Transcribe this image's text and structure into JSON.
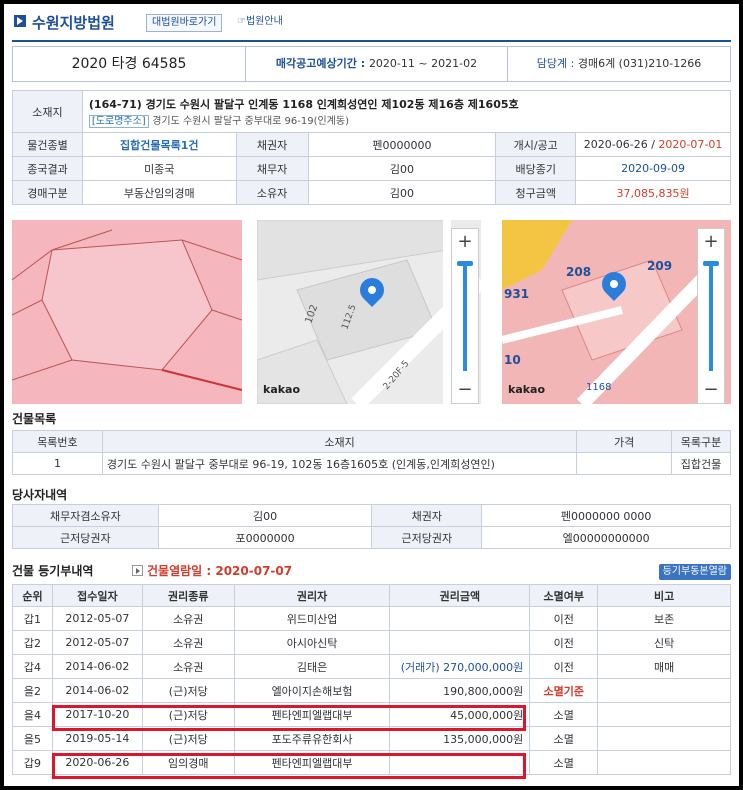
{
  "header": {
    "court_name": "수원지방법원",
    "shortcut_button": "대법원바로가기",
    "guide_button": "법원안내",
    "case_number": "2020 타경 64585",
    "period_label": "매각공고예상기간 : ",
    "period_value": "2020-11 ~ 2021-02",
    "charge_label": "담당계 : ",
    "charge_value": "경매6계 (031)210-1266"
  },
  "info": {
    "location_label": "소재지",
    "address_main": "(164-71) 경기도 수원시 팔달구 인계동 1168 인계희성연인 제102동 제16층 제1605호",
    "road_tag": "[도로명주소]",
    "road_address": "경기도 수원시 팔달구 중부대로 96-19(인계동)",
    "item_type_label": "물건종별",
    "item_type_value": "집합건물목록1건",
    "creditor_label": "채권자",
    "creditor_value": "펜0000000",
    "start_label": "개시/공고",
    "start_value": "2020-06-26 / ",
    "notice_value": "2020-07-01",
    "end_result_label": "종국결과",
    "end_result_value": "미종국",
    "debtor_label": "채무자",
    "debtor_value": "김00",
    "dividend_label": "배당종기",
    "dividend_value": "2020-09-09",
    "auction_type_label": "경매구분",
    "auction_type_value": "부동산임의경매",
    "owner_label": "소유자",
    "owner_value": "김00",
    "claim_label": "청구금액",
    "claim_value": "37,085,835원"
  },
  "maps": {
    "kakao_label": "kakao",
    "map2_labels": [
      "102",
      "112.5",
      "2-20F-5"
    ],
    "map3_labels": [
      "208",
      "209",
      "931",
      "10",
      "1168"
    ]
  },
  "building_list": {
    "title": "건물목록",
    "headers": [
      "목록번호",
      "소재지",
      "가격",
      "목록구분"
    ],
    "rows": [
      [
        "1",
        "경기도 수원시 팔달구 중부대로 96-19, 102동 16층1605호 (인계동,인계희성연인)",
        "",
        "집합건물"
      ]
    ]
  },
  "parties": {
    "title": "당사자내역",
    "rows": [
      [
        "채무자겸소유자",
        "김00",
        "채권자",
        "펜0000000 0000"
      ],
      [
        "근저당권자",
        "포0000000",
        "근저당권자",
        "엘00000000000"
      ]
    ]
  },
  "registry": {
    "title": "건물 등기부내역",
    "view_date": "건물열람일 : 2020-07-07",
    "button": "등기부동본열람",
    "headers": [
      "순위",
      "접수일자",
      "권리종류",
      "권리자",
      "권리금액",
      "소멸여부",
      "비고"
    ],
    "rows": [
      [
        "갑1",
        "2012-05-07",
        "소유권",
        "위드미산업",
        "",
        "이전",
        "보존"
      ],
      [
        "갑2",
        "2012-05-07",
        "소유권",
        "아시아신탁",
        "",
        "이전",
        "신탁"
      ],
      [
        "갑4",
        "2014-06-02",
        "소유권",
        "김태은",
        "(거래가) 270,000,000원",
        "이전",
        "매매"
      ],
      [
        "을2",
        "2014-06-02",
        "(근)저당",
        "엘아이지손해보험",
        "190,800,000원",
        "소멸기준",
        ""
      ],
      [
        "을4",
        "2017-10-20",
        "(근)저당",
        "펜타엔피엘랩대부",
        "45,000,000원",
        "소멸",
        ""
      ],
      [
        "을5",
        "2019-05-14",
        "(근)저당",
        "포도주류유한회사",
        "135,000,000원",
        "소멸",
        ""
      ],
      [
        "갑9",
        "2020-06-26",
        "임의경매",
        "펜타엔피엘랩대부",
        "",
        "소멸",
        ""
      ]
    ]
  },
  "colors": {
    "accent": "#1e4f9c",
    "alert": "#d43c2c",
    "highlight": "#e0142b"
  }
}
